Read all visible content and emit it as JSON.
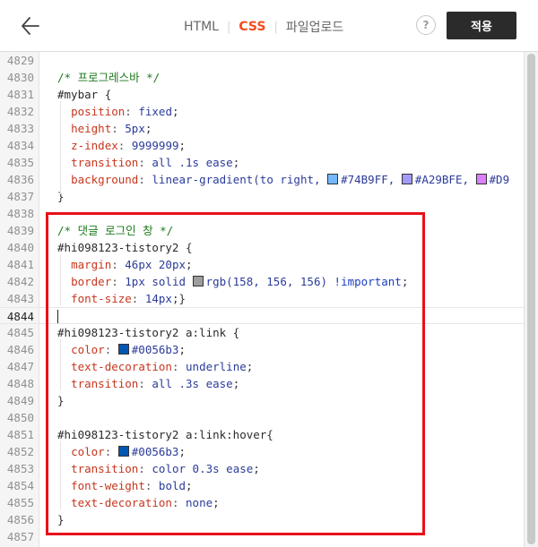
{
  "header": {
    "back_icon": "arrow-left-icon",
    "tabs": [
      {
        "label": "HTML",
        "active": false
      },
      {
        "label": "CSS",
        "active": true
      },
      {
        "label": "파일업로드",
        "active": false
      }
    ],
    "help_label": "?",
    "apply_label": "적용"
  },
  "colors": {
    "accent": "#f24b1e",
    "apply_bg": "#2b2b2b",
    "highlight_border": "#e8101a",
    "comment": "#1e7a1e",
    "property": "#c7361e",
    "value": "#2b3b9a"
  },
  "editor": {
    "current_line": "4844",
    "lines": [
      {
        "n": "4829",
        "tokens": []
      },
      {
        "n": "4830",
        "tokens": [
          {
            "t": "c",
            "v": "/* 프로그레스바 */"
          }
        ]
      },
      {
        "n": "4831",
        "tokens": [
          {
            "t": "s",
            "v": "#mybar "
          },
          {
            "t": "p",
            "v": "{"
          }
        ]
      },
      {
        "n": "4832",
        "tokens": [
          {
            "t": "i"
          },
          {
            "t": "k",
            "v": "position"
          },
          {
            "t": "o",
            "v": ": "
          },
          {
            "t": "v",
            "v": "fixed"
          },
          {
            "t": "p",
            "v": ";"
          }
        ]
      },
      {
        "n": "4833",
        "tokens": [
          {
            "t": "i"
          },
          {
            "t": "k",
            "v": "height"
          },
          {
            "t": "o",
            "v": ": "
          },
          {
            "t": "v",
            "v": "5px"
          },
          {
            "t": "p",
            "v": ";"
          }
        ]
      },
      {
        "n": "4834",
        "tokens": [
          {
            "t": "i"
          },
          {
            "t": "k",
            "v": "z-index"
          },
          {
            "t": "o",
            "v": ": "
          },
          {
            "t": "v",
            "v": "9999999"
          },
          {
            "t": "p",
            "v": ";"
          }
        ]
      },
      {
        "n": "4835",
        "tokens": [
          {
            "t": "i"
          },
          {
            "t": "k",
            "v": "transition"
          },
          {
            "t": "o",
            "v": ": "
          },
          {
            "t": "v",
            "v": "all .1s ease"
          },
          {
            "t": "p",
            "v": ";"
          }
        ]
      },
      {
        "n": "4836",
        "tokens": [
          {
            "t": "i"
          },
          {
            "t": "k",
            "v": "background"
          },
          {
            "t": "o",
            "v": ": "
          },
          {
            "t": "v",
            "v": "linear-gradient(to right, "
          },
          {
            "t": "sw",
            "color": "#74B9FF"
          },
          {
            "t": "v",
            "v": "#74B9FF, "
          },
          {
            "t": "sw",
            "color": "#A29BFE"
          },
          {
            "t": "v",
            "v": "#A29BFE, "
          },
          {
            "t": "sw",
            "color": "#D980FA"
          },
          {
            "t": "v",
            "v": "#D9"
          }
        ]
      },
      {
        "n": "4837",
        "tokens": [
          {
            "t": "p",
            "v": "}"
          }
        ]
      },
      {
        "n": "4838",
        "tokens": []
      },
      {
        "n": "4839",
        "tokens": [
          {
            "t": "c",
            "v": "/* 댓글 로그인 창 */"
          }
        ]
      },
      {
        "n": "4840",
        "tokens": [
          {
            "t": "s",
            "v": "#hi098123-tistory2 "
          },
          {
            "t": "p",
            "v": "{"
          }
        ]
      },
      {
        "n": "4841",
        "tokens": [
          {
            "t": "i"
          },
          {
            "t": "k",
            "v": "margin"
          },
          {
            "t": "o",
            "v": ": "
          },
          {
            "t": "v",
            "v": "46px 20px"
          },
          {
            "t": "p",
            "v": ";"
          }
        ]
      },
      {
        "n": "4842",
        "tokens": [
          {
            "t": "i"
          },
          {
            "t": "k",
            "v": "border"
          },
          {
            "t": "o",
            "v": ": "
          },
          {
            "t": "v",
            "v": "1px solid "
          },
          {
            "t": "sw",
            "color": "#9e9c9c"
          },
          {
            "t": "v",
            "v": "rgb(158, 156, 156) "
          },
          {
            "t": "m",
            "v": "!important"
          },
          {
            "t": "p",
            "v": ";"
          }
        ]
      },
      {
        "n": "4843",
        "tokens": [
          {
            "t": "i"
          },
          {
            "t": "k",
            "v": "font-size"
          },
          {
            "t": "o",
            "v": ": "
          },
          {
            "t": "v",
            "v": "14px"
          },
          {
            "t": "p",
            "v": ";}"
          }
        ]
      },
      {
        "n": "4844",
        "tokens": []
      },
      {
        "n": "4845",
        "tokens": [
          {
            "t": "s",
            "v": "#hi098123-tistory2 a:link "
          },
          {
            "t": "p",
            "v": "{"
          }
        ]
      },
      {
        "n": "4846",
        "tokens": [
          {
            "t": "i"
          },
          {
            "t": "k",
            "v": "color"
          },
          {
            "t": "o",
            "v": ": "
          },
          {
            "t": "sw",
            "color": "#0056b3"
          },
          {
            "t": "v",
            "v": "#0056b3"
          },
          {
            "t": "p",
            "v": ";"
          }
        ]
      },
      {
        "n": "4847",
        "tokens": [
          {
            "t": "i"
          },
          {
            "t": "k",
            "v": "text-decoration"
          },
          {
            "t": "o",
            "v": ": "
          },
          {
            "t": "v",
            "v": "underline"
          },
          {
            "t": "p",
            "v": ";"
          }
        ]
      },
      {
        "n": "4848",
        "tokens": [
          {
            "t": "i"
          },
          {
            "t": "k",
            "v": "transition"
          },
          {
            "t": "o",
            "v": ": "
          },
          {
            "t": "v",
            "v": "all .3s ease"
          },
          {
            "t": "p",
            "v": ";"
          }
        ]
      },
      {
        "n": "4849",
        "tokens": [
          {
            "t": "p",
            "v": "}"
          }
        ]
      },
      {
        "n": "4850",
        "tokens": []
      },
      {
        "n": "4851",
        "tokens": [
          {
            "t": "s",
            "v": "#hi098123-tistory2 a:link:hover"
          },
          {
            "t": "p",
            "v": "{"
          }
        ]
      },
      {
        "n": "4852",
        "tokens": [
          {
            "t": "i"
          },
          {
            "t": "k",
            "v": "color"
          },
          {
            "t": "o",
            "v": ": "
          },
          {
            "t": "sw",
            "color": "#0056b3"
          },
          {
            "t": "v",
            "v": "#0056b3"
          },
          {
            "t": "p",
            "v": ";"
          }
        ]
      },
      {
        "n": "4853",
        "tokens": [
          {
            "t": "i"
          },
          {
            "t": "k",
            "v": "transition"
          },
          {
            "t": "o",
            "v": ": "
          },
          {
            "t": "v",
            "v": "color 0.3s ease"
          },
          {
            "t": "p",
            "v": ";"
          }
        ]
      },
      {
        "n": "4854",
        "tokens": [
          {
            "t": "i"
          },
          {
            "t": "k",
            "v": "font-weight"
          },
          {
            "t": "o",
            "v": ": "
          },
          {
            "t": "v",
            "v": "bold"
          },
          {
            "t": "p",
            "v": ";"
          }
        ]
      },
      {
        "n": "4855",
        "tokens": [
          {
            "t": "i"
          },
          {
            "t": "k",
            "v": "text-decoration"
          },
          {
            "t": "o",
            "v": ": "
          },
          {
            "t": "v",
            "v": "none"
          },
          {
            "t": "p",
            "v": ";"
          }
        ]
      },
      {
        "n": "4856",
        "tokens": [
          {
            "t": "p",
            "v": "}"
          }
        ]
      },
      {
        "n": "4857",
        "tokens": []
      }
    ]
  }
}
